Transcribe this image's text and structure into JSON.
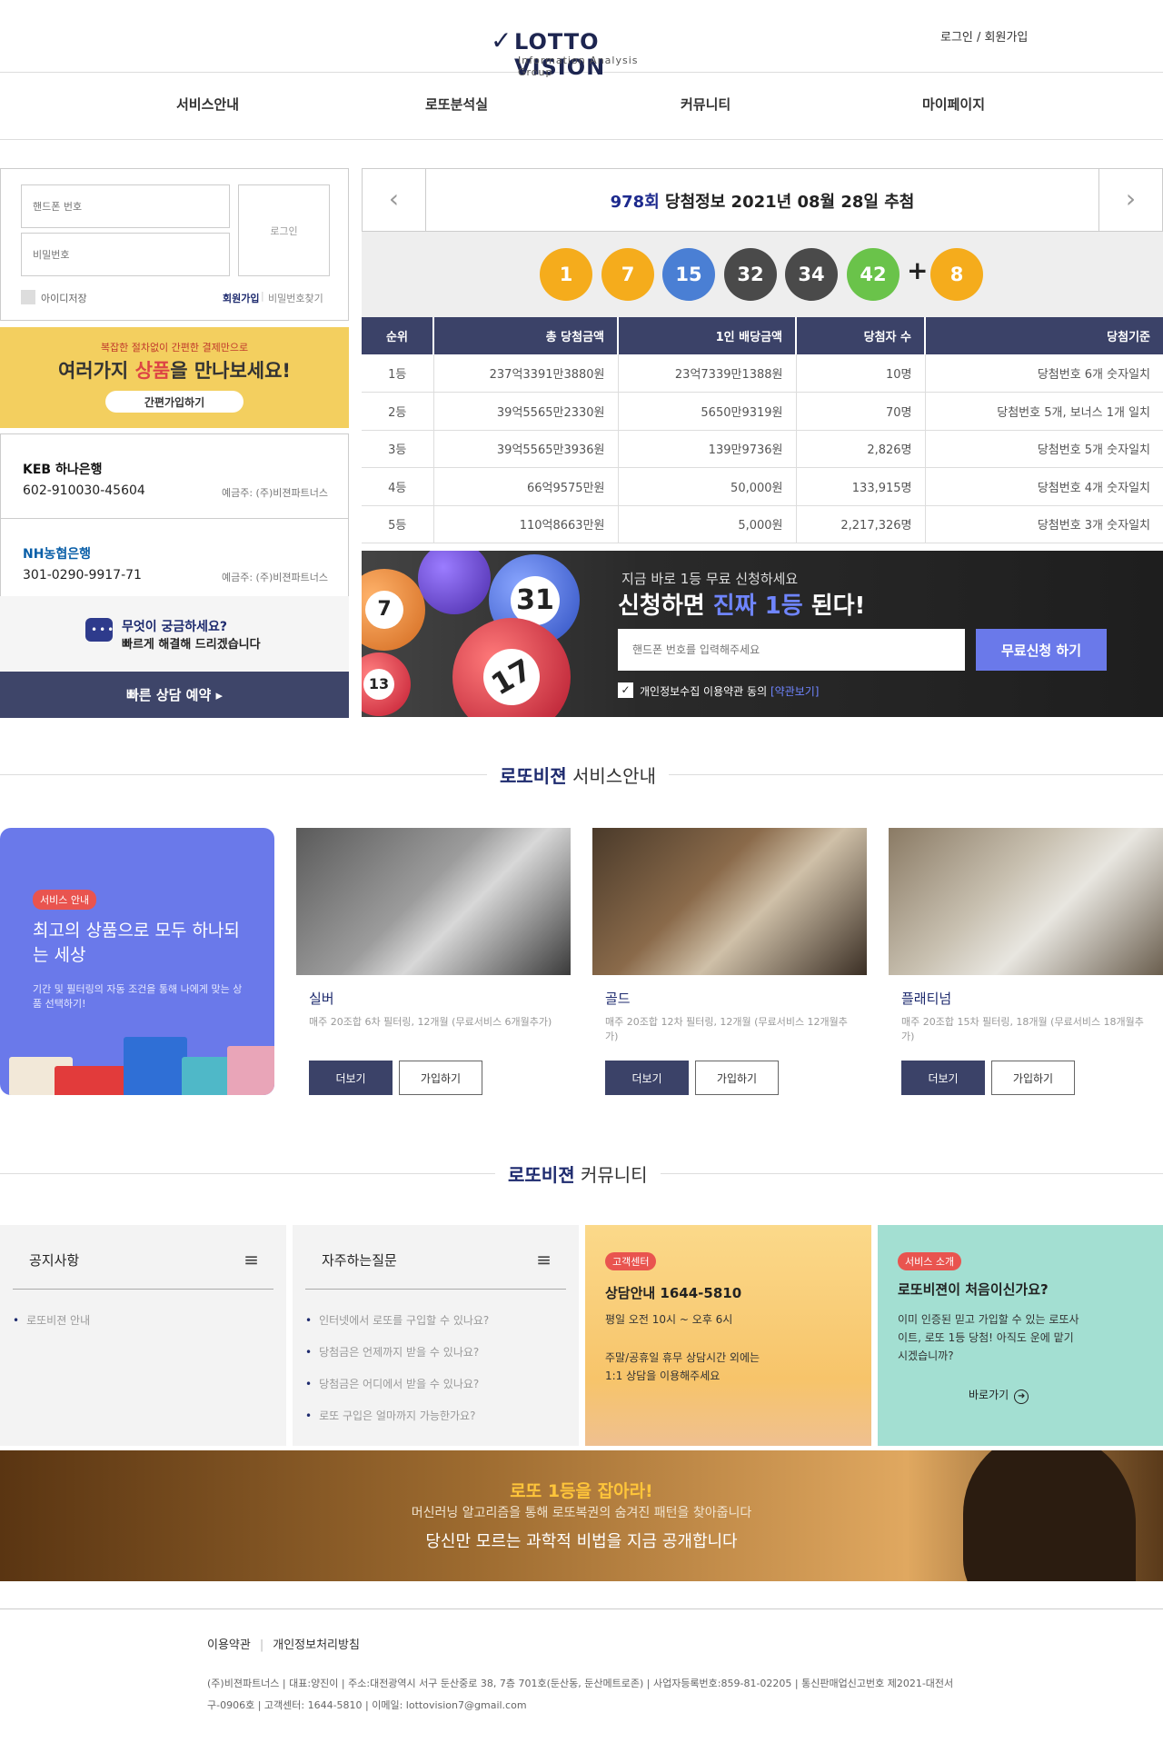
{
  "header": {
    "logo_text": "LOTTO VISION",
    "logo_sub": "Information Analysis Group",
    "login_link": "로그인 / 회원가입"
  },
  "nav": {
    "items": [
      "서비스안내",
      "로또분석실",
      "커뮤니티",
      "마이페이지"
    ]
  },
  "login": {
    "phone_placeholder": "핸드폰 번호",
    "password_placeholder": "비밀번호",
    "login_button": "로그인",
    "save_id": "아이디저장",
    "join": "회원가입",
    "find_password": "비밀번호찾기"
  },
  "promo": {
    "line1": "복잡한 절차없이 간편한 결제만으로",
    "line2_a": "여러가지 ",
    "line2_b": "상품",
    "line2_c": "을 만나보세요!",
    "button": "간편가입하기"
  },
  "banks": [
    {
      "name": "KEB 하나은행",
      "account": "602-910030-45604",
      "holder": "예금주: (주)비젼파트너스",
      "color": "#111"
    },
    {
      "name": "NH농협은행",
      "account": "301-0290-9917-71",
      "holder": "예금주: (주)비젼파트너스",
      "color": "#0a5fa8"
    }
  ],
  "faq": {
    "line1": "무엇이 궁금하세요?",
    "line2": "빠르게 해결해 드리겠습니다",
    "button": "빠른 상담 예약 ▸"
  },
  "draw": {
    "round": "978회",
    "title": "당첨정보 2021년 08월 28일 추첨",
    "prev": "‹",
    "next": "›",
    "balls": [
      {
        "n": "1",
        "color": "#f5ac1c"
      },
      {
        "n": "7",
        "color": "#f5ac1c"
      },
      {
        "n": "15",
        "color": "#4a7fd4"
      },
      {
        "n": "32",
        "color": "#4a4a4a"
      },
      {
        "n": "34",
        "color": "#4a4a4a"
      },
      {
        "n": "42",
        "color": "#6ac34a"
      }
    ],
    "plus": "+",
    "bonus": {
      "n": "8",
      "color": "#f5ac1c"
    }
  },
  "prize_table": {
    "headers": [
      "순위",
      "총 당첨금액",
      "1인 배당금액",
      "당첨자 수",
      "당첨기준"
    ],
    "rows": [
      [
        "1등",
        "237억3391만3880원",
        "23억7339만1388원",
        "10명",
        "당첨번호 6개 숫자일치"
      ],
      [
        "2등",
        "39억5565만2330원",
        "5650만9319원",
        "70명",
        "당첨번호 5개, 보너스 1개 일치"
      ],
      [
        "3등",
        "39억5565만3936원",
        "139만9736원",
        "2,826명",
        "당첨번호 5개 숫자일치"
      ],
      [
        "4등",
        "66억9575만원",
        "50,000원",
        "133,915명",
        "당첨번호 4개 숫자일치"
      ],
      [
        "5등",
        "110억8663만원",
        "5,000원",
        "2,217,326명",
        "당첨번호 3개 숫자일치"
      ]
    ]
  },
  "apply": {
    "line1": "지금 바로 1등 무료 신청하세요",
    "line2_a": "신청하면 ",
    "line2_b": "진짜 1등",
    "line2_c": " 된다!",
    "placeholder": "핸드폰 번호를 입력해주세요",
    "button": "무료신청 하기",
    "agree": "개인정보수집 이용약관 동의 ",
    "agree_link": "[약관보기]",
    "check": "✓",
    "ball_numbers": [
      "7",
      "31",
      "17",
      "13"
    ]
  },
  "services": {
    "title_a": "로또비젼",
    "title_b": " 서비스안내",
    "intro": {
      "badge": "서비스 안내",
      "title": "최고의 상품으로 모두 하나되는 세상",
      "desc": "기간 및 필터링의 자동 조건을 통해 나에게 맞는 상품 선택하기!"
    },
    "items": [
      {
        "name": "실버",
        "desc": "매주 20조합 6차 필터링, 12개월 (무료서비스 6개월추가)",
        "more": "더보기",
        "join": "가입하기"
      },
      {
        "name": "골드",
        "desc": "매주 20조합 12차 필터링, 12개월 (무료서비스 12개월추가)",
        "more": "더보기",
        "join": "가입하기"
      },
      {
        "name": "플래티넘",
        "desc": "매주 20조합 15차 필터링, 18개월 (무료서비스 18개월추가)",
        "more": "더보기",
        "join": "가입하기"
      }
    ]
  },
  "community": {
    "title_a": "로또비젼",
    "title_b": " 커뮤니티",
    "notice": {
      "title": "공지사항",
      "items": [
        "로또비젼 안내"
      ]
    },
    "qna": {
      "title": "자주하는질문",
      "items": [
        "인터넷에서 로또를 구입할 수 있나요?",
        "당첨금은 언제까지 받을 수 있나요?",
        "당첨금은 어디에서 받을 수 있나요?",
        "로또 구입은 얼마까지 가능한가요?"
      ]
    },
    "center": {
      "badge": "고객센터",
      "title": "상담안내 1644-5810",
      "hours": "평일 오전 10시 ~ 오후 6시",
      "holiday": "주말/공휴일 휴무 상담시간 외에는 1:1 상담을 이용해주세요"
    },
    "intro": {
      "badge": "서비스 소개",
      "title": "로또비젼이 처음이신가요?",
      "desc": "이미 인증된 믿고 가입할 수 있는 로또사이트, 로또 1등 당첨! 아직도 운에 맡기시겠습니까?",
      "button": "바로가기",
      "arrow": "➜"
    }
  },
  "catch": {
    "line1": "로또 1등을 잡아라!",
    "line2": "머신러닝 알고리즘을 통해 로또복권의 숨겨진 패턴을 찾아줍니다",
    "line3": "당신만 모르는 과학적 비법을 지금 공개합니다"
  },
  "footer": {
    "terms": "이용약관",
    "privacy": "개인정보처리방침",
    "info": "(주)비젼파트너스 | 대표:양진이 | 주소:대전광역시 서구 둔산중로 38, 7층 701호(둔산동, 둔산메트로존) | 사업자등록번호:859-81-02205 | 통신판매업신고번호 제2021-대전서구-0906호 | 고객센터: 1644-5810 | 이메일: lottovision7@gmail.com"
  }
}
